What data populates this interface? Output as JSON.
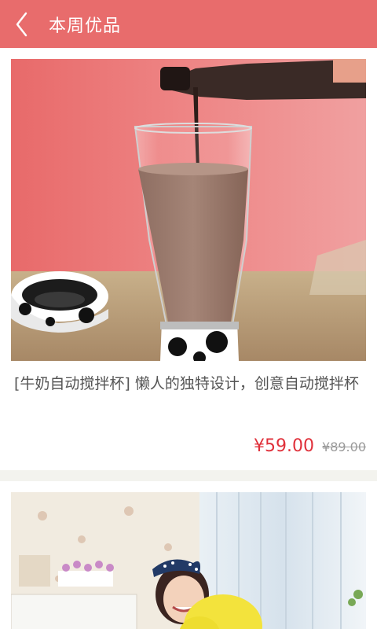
{
  "header": {
    "title": "本周优品"
  },
  "products": [
    {
      "title": "[牛奶自动搅拌杯]  懒人的独特设计，创意自动搅拌杯",
      "price": "¥59.00",
      "original_price": "¥89.00"
    }
  ],
  "icons": {
    "back": "chevron-left-icon"
  },
  "colors": {
    "header_bg": "#e86c6c",
    "price": "#e0313b",
    "original_price": "#9a9a9a"
  }
}
